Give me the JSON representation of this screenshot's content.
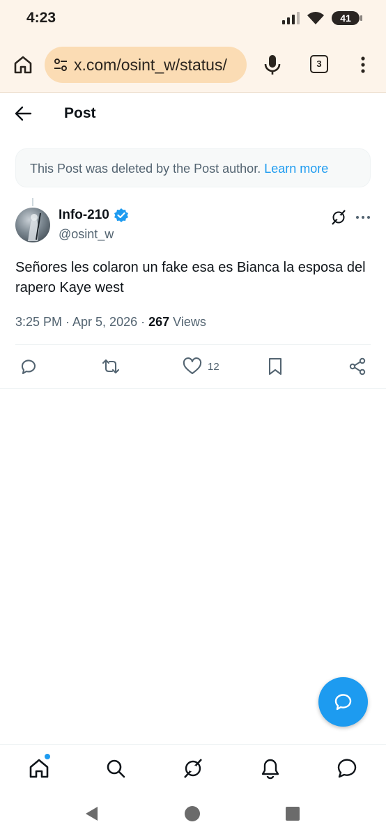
{
  "status_bar": {
    "time": "4:23",
    "battery": "41"
  },
  "browser": {
    "url": "x.com/osint_w/status/",
    "tab_count": "3"
  },
  "header": {
    "title": "Post"
  },
  "notice": {
    "text": "This Post was deleted by the Post author. ",
    "link": "Learn more"
  },
  "post": {
    "author_name": "Info-210",
    "author_handle": "@osint_w",
    "text": "Señores les colaron un fake esa es Bianca la esposa del rapero Kaye west",
    "time": "3:25 PM · Apr 5, 2026 · ",
    "views_count": "267",
    "views_label": " Views",
    "likes": "12"
  },
  "colors": {
    "accent": "#1d9bf0",
    "browser_bg": "#fdf4ea",
    "url_pill": "#fbdcb4",
    "muted": "#536471"
  },
  "icons": {
    "browser": [
      "home-icon",
      "site-settings-icon",
      "mic-icon",
      "tabs-icon",
      "more-vert-icon"
    ],
    "header": [
      "back-arrow-icon"
    ],
    "post": [
      "verified-badge-icon",
      "grok-icon",
      "more-horizontal-icon"
    ],
    "actions": [
      "reply-icon",
      "repost-icon",
      "like-icon",
      "bookmark-icon",
      "share-icon"
    ],
    "nav": [
      "home-icon",
      "search-icon",
      "grok-icon",
      "notifications-icon",
      "messages-icon"
    ],
    "fab": "chat-compose-icon",
    "system": [
      "back-triangle-icon",
      "home-circle-icon",
      "recents-square-icon"
    ]
  }
}
